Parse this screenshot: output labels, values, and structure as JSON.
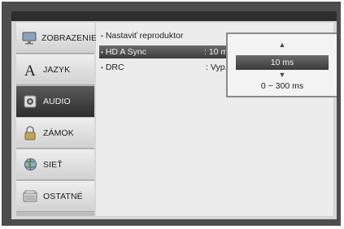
{
  "sidebar": {
    "items": [
      {
        "label": "ZOBRAZENIE",
        "icon": "monitor-icon",
        "active": false
      },
      {
        "label": "JAZYK",
        "icon": "letter-a-icon",
        "active": false
      },
      {
        "label": "AUDIO",
        "icon": "speaker-icon",
        "active": true
      },
      {
        "label": "ZÁMOK",
        "icon": "lock-icon",
        "active": false
      },
      {
        "label": "SIEŤ",
        "icon": "globe-icon",
        "active": false
      },
      {
        "label": "OSTATNÉ",
        "icon": "box-icon",
        "active": false
      }
    ]
  },
  "content": {
    "rows": [
      {
        "label": "Nastaviť reproduktor",
        "value": ""
      },
      {
        "label": "HD A Sync",
        "value": ": 10 m"
      },
      {
        "label": "DRC",
        "value": ": Vyp."
      }
    ]
  },
  "popup": {
    "up_arrow": "▲",
    "value": "10 ms",
    "down_arrow": "▼",
    "range": "0 ~ 300 ms"
  },
  "colors": {
    "active_bg": "#3a3a3a",
    "panel_bg": "#ececec",
    "frame": "#4d4d4d"
  }
}
